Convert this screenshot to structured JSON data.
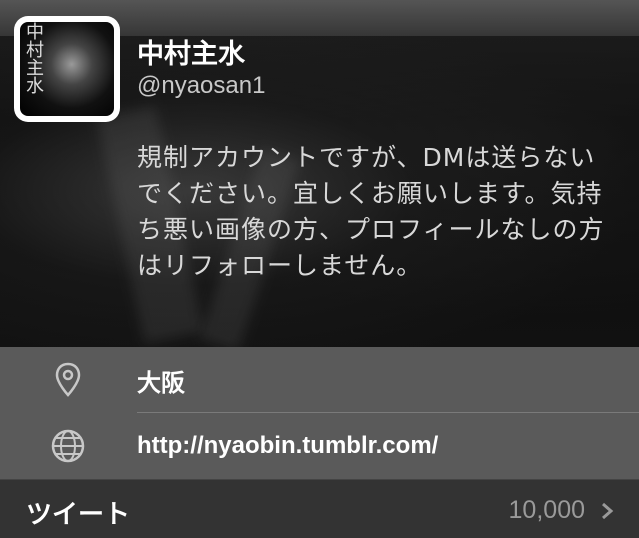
{
  "profile": {
    "name": "中村主水",
    "handle": "@nyaosan1",
    "avatar_text": "中村主水",
    "bio": "規制アカウントですが、DMは送らないでください。宜しくお願いします。気持ち悪い画像の方、プロフィールなしの方はリフォローしません。"
  },
  "info": {
    "location": "大阪",
    "website": "http://nyaobin.tumblr.com/"
  },
  "tweets": {
    "label": "ツイート",
    "count": "10,000"
  },
  "icons": {
    "location": "location-pin-icon",
    "website": "globe-icon",
    "tweets": "chevron-right-icon"
  },
  "colors": {
    "info_bg": "#5a5a5a",
    "tweets_bg": "#333333",
    "muted": "#9a9a9a"
  }
}
